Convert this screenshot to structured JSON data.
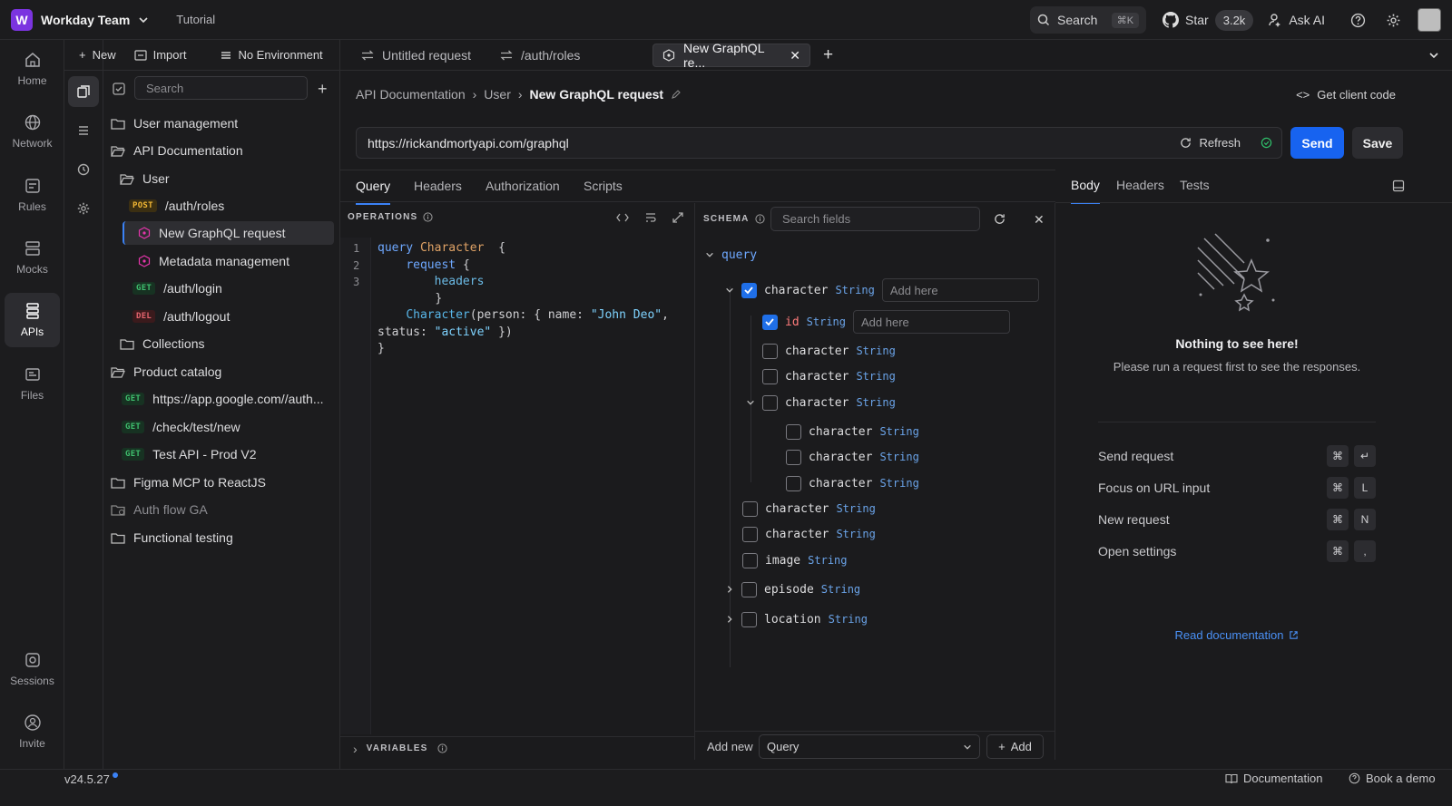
{
  "workspace": {
    "initial": "W",
    "name": "Workday Team",
    "tutorial": "Tutorial"
  },
  "topbar": {
    "search": "Search",
    "search_kbd": "⌘K",
    "star": "Star",
    "star_count": "3.2k",
    "ask_ai": "Ask AI"
  },
  "rail": [
    "Home",
    "Network",
    "Rules",
    "Mocks",
    "APIs",
    "Files",
    "Sessions",
    "Invite"
  ],
  "treebar": {
    "new": "New",
    "import": "Import",
    "env": "No Environment",
    "search_placeholder": "Search"
  },
  "tree": [
    {
      "label": "User management"
    },
    {
      "label": "API Documentation"
    },
    {
      "label": "User"
    },
    {
      "method": "POST",
      "label": "/auth/roles"
    },
    {
      "label": "New GraphQL request"
    },
    {
      "label": "Metadata management"
    },
    {
      "method": "GET",
      "label": "/auth/login"
    },
    {
      "method": "DEL",
      "label": "/auth/logout"
    },
    {
      "label": "Collections"
    },
    {
      "label": "Product catalog"
    },
    {
      "method": "GET",
      "label": "https://app.google.com//auth..."
    },
    {
      "method": "GET",
      "label": "/check/test/new"
    },
    {
      "method": "GET",
      "label": "Test API - Prod V2"
    },
    {
      "label": "Figma MCP to ReactJS"
    },
    {
      "label": "Auth flow GA"
    },
    {
      "label": "Functional testing"
    }
  ],
  "tabs": [
    "Untitled request",
    "/auth/roles",
    "New GraphQL re..."
  ],
  "breadcrumb": [
    "API Documentation",
    "User",
    "New GraphQL request"
  ],
  "get_client_code": "Get client code",
  "request": {
    "url": "https://rickandmortyapi.com/graphql",
    "refresh": "Refresh",
    "send": "Send",
    "save": "Save"
  },
  "subtabs": [
    "Query",
    "Headers",
    "Authorization",
    "Scripts"
  ],
  "operations": {
    "label": "OPERATIONS",
    "variables": "VARIABLES",
    "line_numbers": [
      "1",
      "2",
      "3"
    ],
    "code": {
      "l1a": "query",
      "l1b": "Character",
      "l1c": "{",
      "l2a": "request",
      "l2b": "{",
      "l3": "headers",
      "l4": "}",
      "l5a": "Character",
      "l5b": "(person: { name: ",
      "l5c": "\"John Deo\"",
      "l5d": ",",
      "l6a": "status: ",
      "l6b": "\"active\"",
      "l6c": " })",
      "l7": "}"
    }
  },
  "schema": {
    "label": "SCHEMA",
    "search_placeholder": "Search fields",
    "root": "query",
    "rows": [
      {
        "name": "character",
        "type": "String",
        "checked": true
      },
      {
        "name": "id",
        "type": "String",
        "checked": true
      },
      {
        "name": "character",
        "type": "String"
      },
      {
        "name": "character",
        "type": "String"
      },
      {
        "name": "character",
        "type": "String"
      },
      {
        "name": "character",
        "type": "String"
      },
      {
        "name": "character",
        "type": "String"
      },
      {
        "name": "character",
        "type": "String"
      },
      {
        "name": "character",
        "type": "String"
      },
      {
        "name": "character",
        "type": "String"
      },
      {
        "name": "image",
        "type": "String"
      },
      {
        "name": "episode",
        "type": "String"
      },
      {
        "name": "location",
        "type": "String"
      }
    ],
    "add_placeholder": "Add here",
    "add_new": "Add new",
    "add_select": "Query",
    "add_button": "Add"
  },
  "response": {
    "tabs": [
      "Body",
      "Headers",
      "Tests"
    ],
    "empty_title": "Nothing to see here!",
    "empty_sub": "Please run a request first to see the responses.",
    "shortcuts": [
      {
        "label": "Send request",
        "k1": "⌘",
        "k2": "↵"
      },
      {
        "label": "Focus on URL input",
        "k1": "⌘",
        "k2": "L"
      },
      {
        "label": "New request",
        "k1": "⌘",
        "k2": "N"
      },
      {
        "label": "Open settings",
        "k1": "⌘",
        "k2": ","
      }
    ],
    "read_docs": "Read documentation"
  },
  "status": {
    "version": "v24.5.27",
    "documentation": "Documentation",
    "book_demo": "Book a demo"
  },
  "colors": {
    "accent": "#1763f0",
    "brand": "#7b34e0",
    "bg": "#1b1b1d"
  }
}
